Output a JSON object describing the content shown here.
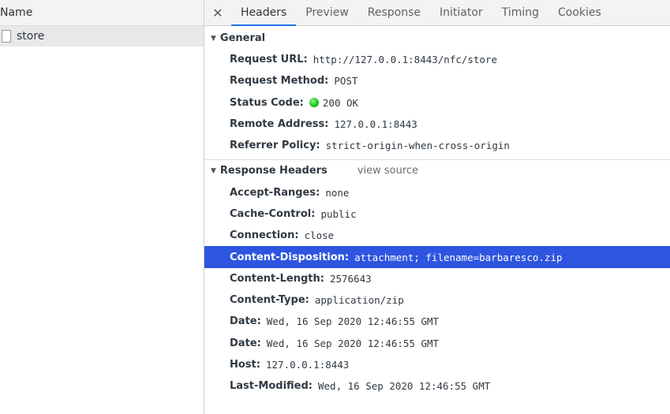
{
  "left": {
    "header": "Name",
    "requests": [
      {
        "name": "store"
      }
    ]
  },
  "tabs": {
    "close_icon": "close-icon",
    "items": [
      "Headers",
      "Preview",
      "Response",
      "Initiator",
      "Timing",
      "Cookies"
    ],
    "active": "Headers"
  },
  "general": {
    "title": "General",
    "rows": [
      {
        "key": "Request URL:",
        "value": "http://127.0.0.1:8443/nfc/store"
      },
      {
        "key": "Request Method:",
        "value": "POST"
      },
      {
        "key": "Status Code:",
        "value": "200 OK"
      },
      {
        "key": "Remote Address:",
        "value": "127.0.0.1:8443"
      },
      {
        "key": "Referrer Policy:",
        "value": "strict-origin-when-cross-origin"
      }
    ]
  },
  "response_headers": {
    "title": "Response Headers",
    "view_source": "view source",
    "rows": [
      {
        "key": "Accept-Ranges:",
        "value": "none"
      },
      {
        "key": "Cache-Control:",
        "value": "public"
      },
      {
        "key": "Connection:",
        "value": "close"
      },
      {
        "key": "Content-Disposition:",
        "value": "attachment; filename=barbaresco.zip"
      },
      {
        "key": "Content-Length:",
        "value": "2576643"
      },
      {
        "key": "Content-Type:",
        "value": "application/zip"
      },
      {
        "key": "Date:",
        "value": "Wed, 16 Sep 2020 12:46:55 GMT"
      },
      {
        "key": "Date:",
        "value": "Wed, 16 Sep 2020 12:46:55 GMT"
      },
      {
        "key": "Host:",
        "value": "127.0.0.1:8443"
      },
      {
        "key": "Last-Modified:",
        "value": "Wed, 16 Sep 2020 12:46:55 GMT"
      }
    ]
  },
  "colors": {
    "highlight": "#2e55e0",
    "status_ok": "#0fb20f",
    "active_tab_underline": "#1a73e8"
  }
}
